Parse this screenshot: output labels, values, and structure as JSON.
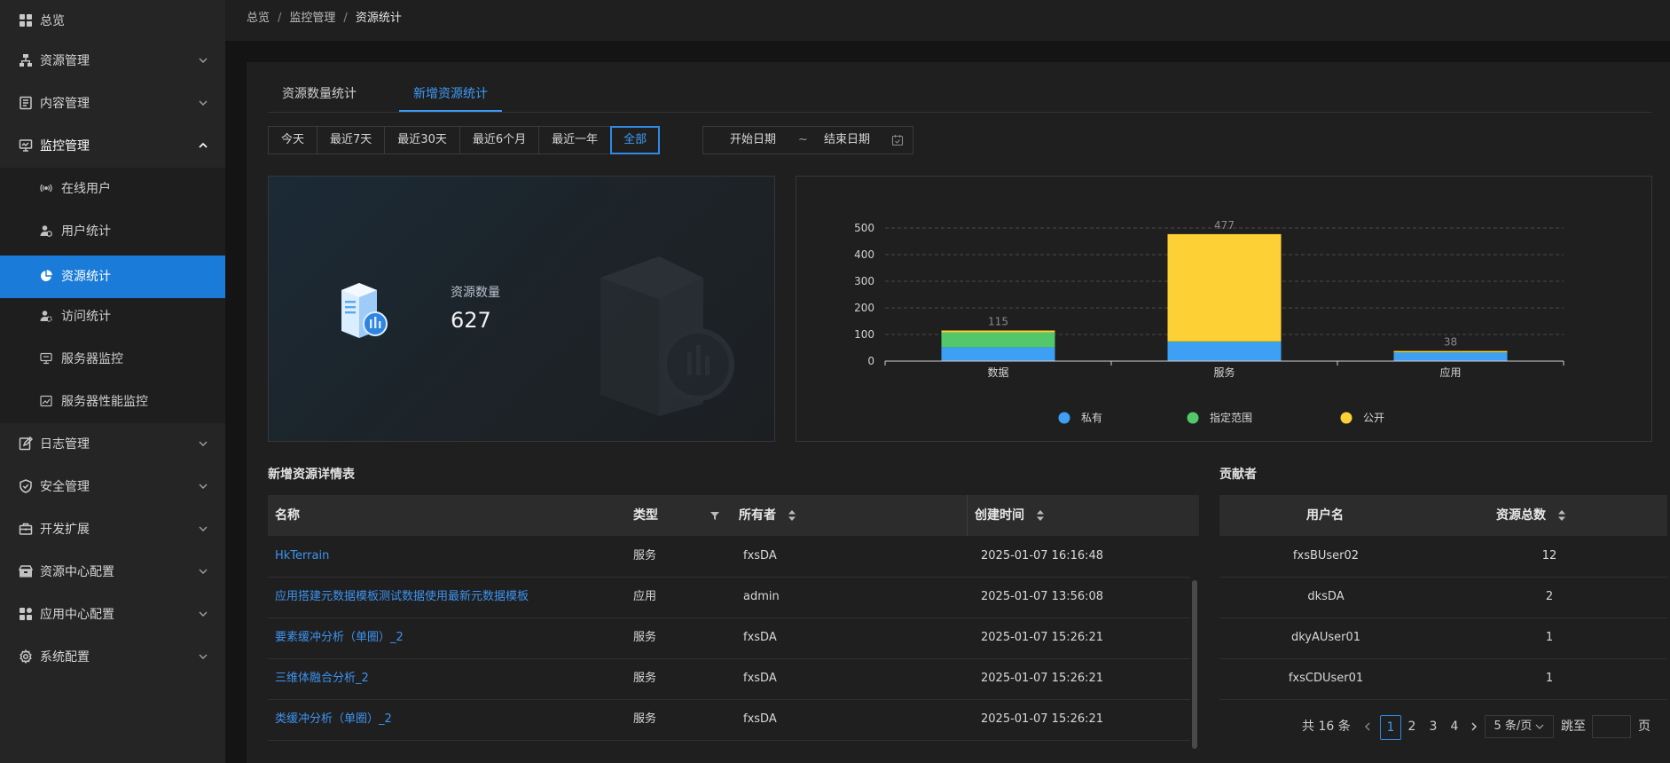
{
  "sidebar": {
    "items": [
      {
        "label": "总览",
        "icon": "grid-icon"
      },
      {
        "label": "资源管理",
        "icon": "sitemap-icon"
      },
      {
        "label": "内容管理",
        "icon": "document-icon"
      },
      {
        "label": "监控管理",
        "icon": "monitor-icon"
      },
      {
        "label": "日志管理",
        "icon": "edit-icon"
      },
      {
        "label": "安全管理",
        "icon": "shield-icon"
      },
      {
        "label": "开发扩展",
        "icon": "toolbox-icon"
      },
      {
        "label": "资源中心配置",
        "icon": "package-icon"
      },
      {
        "label": "应用中心配置",
        "icon": "apps-icon"
      },
      {
        "label": "系统配置",
        "icon": "gear-icon"
      }
    ],
    "submenu": [
      {
        "label": "在线用户",
        "icon": "signal-icon"
      },
      {
        "label": "用户统计",
        "icon": "user-stat-icon"
      },
      {
        "label": "资源统计",
        "icon": "pie-icon"
      },
      {
        "label": "访问统计",
        "icon": "user-gear-icon"
      },
      {
        "label": "服务器监控",
        "icon": "screen-icon"
      },
      {
        "label": "服务器性能监控",
        "icon": "line-chart-icon"
      }
    ]
  },
  "breadcrumb": {
    "root": "总览",
    "parent": "监控管理",
    "current": "资源统计",
    "separator": "/"
  },
  "tabs": [
    "资源数量统计",
    "新增资源统计"
  ],
  "range_buttons": [
    "今天",
    "最近7天",
    "最近30天",
    "最近6个月",
    "最近一年",
    "全部"
  ],
  "date_range": {
    "start": "开始日期",
    "sep": "~",
    "end": "结束日期"
  },
  "summary": {
    "label": "资源数量",
    "value": "627"
  },
  "chart_data": {
    "type": "bar",
    "stacked": true,
    "categories": [
      "数据",
      "服务",
      "应用"
    ],
    "series": [
      {
        "name": "私有",
        "color": "#3ea0f5",
        "values": [
          52,
          72,
          32
        ]
      },
      {
        "name": "指定范围",
        "color": "#52c86a",
        "values": [
          56,
          2,
          1
        ]
      },
      {
        "name": "公开",
        "color": "#fdd135",
        "values": [
          7,
          403,
          5
        ]
      }
    ],
    "totals": [
      115,
      477,
      38
    ],
    "ylim": [
      0,
      500
    ],
    "yticks": [
      0,
      100,
      200,
      300,
      400,
      500
    ],
    "grid": true,
    "legend": "bottom"
  },
  "detail_table": {
    "title": "新增资源详情表",
    "columns": [
      "名称",
      "类型",
      "所有者",
      "创建时间"
    ],
    "rows": [
      {
        "name": "HkTerrain",
        "type": "服务",
        "owner": "fxsDA",
        "time": "2025-01-07 16:16:48"
      },
      {
        "name": "应用搭建元数据模板测试数据使用最新元数据模板",
        "type": "应用",
        "owner": "admin",
        "time": "2025-01-07 13:56:08"
      },
      {
        "name": "要素缓冲分析（单圈）_2",
        "type": "服务",
        "owner": "fxsDA",
        "time": "2025-01-07 15:26:21"
      },
      {
        "name": "三维体融合分析_2",
        "type": "服务",
        "owner": "fxsDA",
        "time": "2025-01-07 15:26:21"
      },
      {
        "name": "类缓冲分析（单圈）_2",
        "type": "服务",
        "owner": "fxsDA",
        "time": "2025-01-07 15:26:21"
      }
    ]
  },
  "contributors": {
    "title": "贡献者",
    "columns": [
      "用户名",
      "资源总数"
    ],
    "rows": [
      {
        "user": "fxsBUser02",
        "count": "12"
      },
      {
        "user": "dksDA",
        "count": "2"
      },
      {
        "user": "dkyAUser01",
        "count": "1"
      },
      {
        "user": "fxsCDUser01",
        "count": "1"
      }
    ],
    "pager": {
      "total": "共 16 条",
      "pages": [
        "1",
        "2",
        "3",
        "4"
      ],
      "current": "1",
      "page_size": "5 条/页",
      "jump_label": "跳至",
      "page_unit": "页"
    }
  },
  "colors": {
    "accent": "#1a7bd8",
    "link": "#3e93ee"
  }
}
